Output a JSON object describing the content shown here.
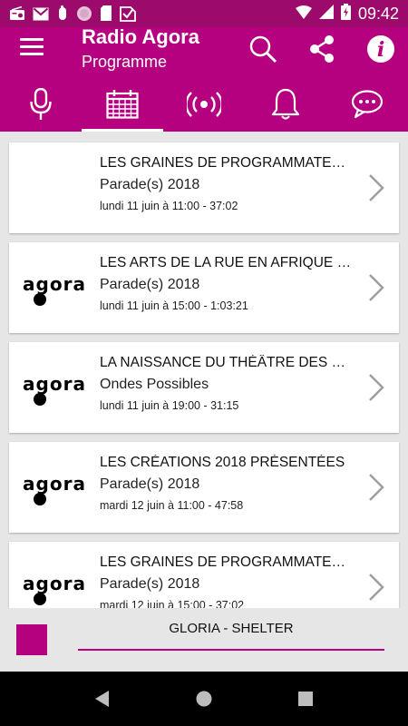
{
  "status_bar": {
    "time": "09:42",
    "icons": [
      "radio-icon",
      "gmail-icon",
      "hand-icon",
      "circle-icon",
      "sd-card-icon",
      "check-icon",
      "wifi-icon",
      "signal-icon",
      "battery-icon"
    ]
  },
  "app_bar": {
    "title": "Radio Agora",
    "subtitle": "Programme",
    "actions": [
      "search-icon",
      "share-icon",
      "info-icon"
    ]
  },
  "tabs": [
    {
      "name": "tab-microphone",
      "icon": "microphone-icon",
      "selected": false
    },
    {
      "name": "tab-programme",
      "icon": "calendar-icon",
      "selected": true
    },
    {
      "name": "tab-live",
      "icon": "broadcast-icon",
      "selected": false
    },
    {
      "name": "tab-notifications",
      "icon": "bell-icon",
      "selected": false
    },
    {
      "name": "tab-messages",
      "icon": "chat-icon",
      "selected": false
    }
  ],
  "programmes": [
    {
      "title": "LES GRAINES DE PROGRAMMATEURS",
      "show": "Parade(s) 2018",
      "date": "lundi 11 juin à 11:00 - 37:02",
      "has_logo": false
    },
    {
      "title": "LES ARTS DE LA RUE EN AFRIQUE DU SUD",
      "show": "Parade(s) 2018",
      "date": "lundi 11 juin à 15:00 - 1:03:21",
      "has_logo": true
    },
    {
      "title": "LA NAISSANCE DU THÉÂTRE DES MERVEILLES",
      "show": "Ondes Possibles",
      "date": "lundi 11 juin à 19:00 - 31:15",
      "has_logo": true
    },
    {
      "title": "LES CRÉATIONS 2018 PRÉSENTÉES",
      "show": "Parade(s) 2018",
      "date": "mardi 12 juin à 11:00 - 47:58",
      "has_logo": true
    },
    {
      "title": "LES GRAINES DE PROGRAMMATEURS",
      "show": "Parade(s) 2018",
      "date": "mardi 12 juin à 15:00 - 37:02",
      "has_logo": true
    }
  ],
  "logo_text": "agora",
  "player": {
    "track": "GLORIA - SHELTER"
  },
  "colors": {
    "brand": "#b5007f",
    "status_bar": "#9c0a6b"
  }
}
